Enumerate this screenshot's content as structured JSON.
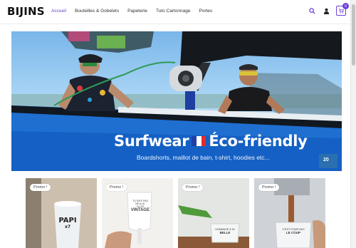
{
  "header": {
    "logo": "BIJINS",
    "nav": [
      "Accueil",
      "Bouteilles & Gobelets",
      "Papeterie",
      "Tuto Cartonnage",
      "Portes"
    ],
    "cart_count": "0",
    "accent": "#6d3fd6"
  },
  "hero": {
    "title_left": "Surfwear",
    "title_right": "Éco-friendly",
    "subtitle": "Boardshorts, maillot de bain, t-shirt, hoodies etc...",
    "boat_badge": "20"
  },
  "products": [
    {
      "badge": "Promo !",
      "print": [
        "PAPI",
        "x7"
      ]
    },
    {
      "badge": "Promo !",
      "print": [
        "TU N'ES PAS VIEILLE,",
        "TU ES",
        "VINTAGE"
      ]
    },
    {
      "badge": "Promo !",
      "print": [
        "HOMMAGE À TA",
        "BELLE"
      ]
    },
    {
      "badge": "Promo !",
      "print": [
        "C'EST POUR MOI",
        "LE COUP"
      ]
    }
  ]
}
